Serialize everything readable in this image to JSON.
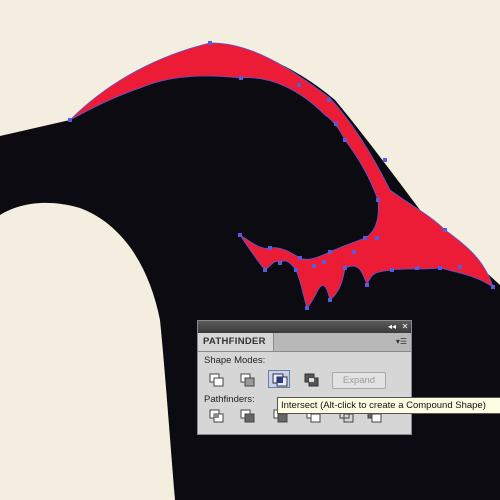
{
  "pathfinder": {
    "title": "PATHFINDER",
    "shape_modes_label": "Shape Modes:",
    "pathfinders_label": "Pathfinders:",
    "expand_label": "Expand",
    "collapse_glyph": "◂◂",
    "close_glyph": "✕",
    "menu_glyph": "▾☰",
    "shape_mode_buttons": [
      "unite-icon",
      "minus-front-icon",
      "intersect-icon",
      "exclude-icon"
    ],
    "pathfinder_buttons": [
      "divide-icon",
      "trim-icon",
      "merge-icon",
      "crop-icon",
      "outline-icon",
      "minus-back-icon"
    ],
    "active_button": "intersect-icon"
  },
  "tooltip": {
    "text": "Intersect (Alt-click to create a Compound Shape)"
  },
  "colors": {
    "paper": "#f3eee0",
    "silhouette": "#0c0b12",
    "selection_fill": "#ec1b36",
    "anchor_points": "#5a5bd6",
    "panel_bg": "#d6d6d6"
  }
}
